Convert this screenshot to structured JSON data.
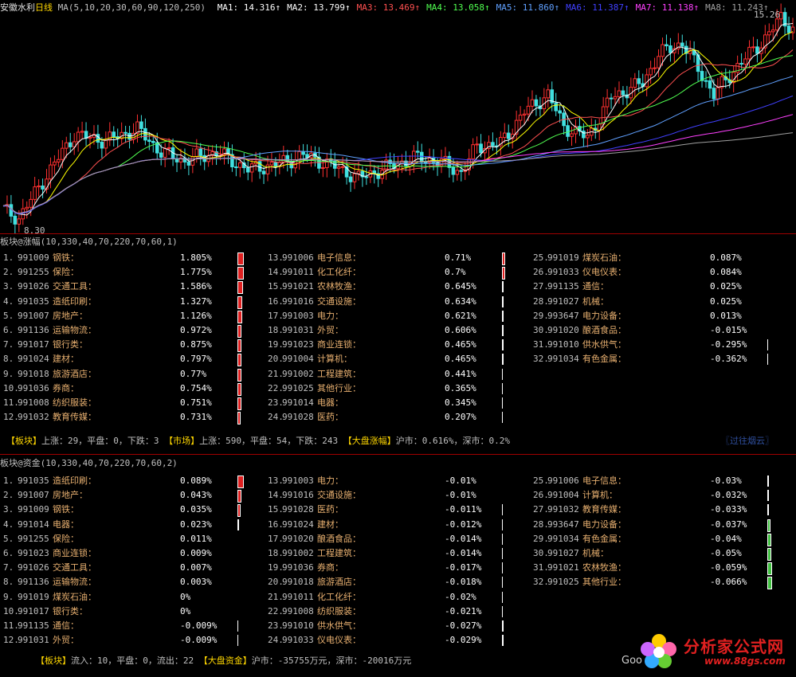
{
  "header": {
    "stock_name": "安徽水利",
    "period": "日线",
    "ma_params": "MA(5,10,20,30,60,90,120,250)",
    "ma_values": [
      {
        "label": "MA1:",
        "value": "14.316↑",
        "color": "#ffffff"
      },
      {
        "label": "MA2:",
        "value": "13.799↑",
        "color": "#ffffff"
      },
      {
        "label": "MA3:",
        "value": "13.469↑",
        "color": "#ff5050"
      },
      {
        "label": "MA4:",
        "value": "13.058↑",
        "color": "#50ff50"
      },
      {
        "label": "MA5:",
        "value": "11.860↑",
        "color": "#60a0ff"
      },
      {
        "label": "MA6:",
        "value": "11.387↑",
        "color": "#4040ff"
      },
      {
        "label": "MA7:",
        "value": "11.138↑",
        "color": "#ff40ff"
      },
      {
        "label": "MA8:",
        "value": "11.243↑",
        "color": "#a0a0a0"
      }
    ],
    "high_label": "15.26",
    "low_label": "8.30"
  },
  "rise_panel": {
    "title": "板块@涨幅(10,330,40,70,220,70,60,1)",
    "items": [
      {
        "rank": "1.",
        "code": "991009",
        "name": "钢铁：",
        "value": "1.805%",
        "bar": 1.805
      },
      {
        "rank": "2.",
        "code": "991255",
        "name": "保险：",
        "value": "1.775%",
        "bar": 1.775
      },
      {
        "rank": "3.",
        "code": "991026",
        "name": "交通工具：",
        "value": "1.586%",
        "bar": 1.586
      },
      {
        "rank": "4.",
        "code": "991035",
        "name": "造纸印刷：",
        "value": "1.327%",
        "bar": 1.327
      },
      {
        "rank": "5.",
        "code": "991007",
        "name": "房地产：",
        "value": "1.126%",
        "bar": 1.126
      },
      {
        "rank": "6.",
        "code": "991136",
        "name": "运输物流：",
        "value": "0.972%",
        "bar": 0.972
      },
      {
        "rank": "7.",
        "code": "991017",
        "name": "银行类：",
        "value": "0.875%",
        "bar": 0.875
      },
      {
        "rank": "8.",
        "code": "991024",
        "name": "建材：",
        "value": "0.797%",
        "bar": 0.797
      },
      {
        "rank": "9.",
        "code": "991018",
        "name": "旅游酒店：",
        "value": "0.77%",
        "bar": 0.77
      },
      {
        "rank": "10.",
        "code": "991036",
        "name": "券商：",
        "value": "0.754%",
        "bar": 0.754
      },
      {
        "rank": "11.",
        "code": "991008",
        "name": "纺织服装：",
        "value": "0.751%",
        "bar": 0.751
      },
      {
        "rank": "12.",
        "code": "991032",
        "name": "教育传媒：",
        "value": "0.731%",
        "bar": 0.731
      },
      {
        "rank": "13.",
        "code": "991006",
        "name": "电子信息：",
        "value": "0.71%",
        "bar": 0.71
      },
      {
        "rank": "14.",
        "code": "991011",
        "name": "化工化纤：",
        "value": "0.7%",
        "bar": 0.7
      },
      {
        "rank": "15.",
        "code": "991021",
        "name": "农林牧渔：",
        "value": "0.645%",
        "bar": 0.645
      },
      {
        "rank": "16.",
        "code": "991016",
        "name": "交通设施：",
        "value": "0.634%",
        "bar": 0.634
      },
      {
        "rank": "17.",
        "code": "991003",
        "name": "电力：",
        "value": "0.621%",
        "bar": 0.621
      },
      {
        "rank": "18.",
        "code": "991031",
        "name": "外贸：",
        "value": "0.606%",
        "bar": 0.606
      },
      {
        "rank": "19.",
        "code": "991023",
        "name": "商业连锁：",
        "value": "0.465%",
        "bar": 0.465
      },
      {
        "rank": "20.",
        "code": "991004",
        "name": "计算机：",
        "value": "0.465%",
        "bar": 0.465
      },
      {
        "rank": "21.",
        "code": "991002",
        "name": "工程建筑：",
        "value": "0.441%",
        "bar": 0.441
      },
      {
        "rank": "22.",
        "code": "991025",
        "name": "其他行业：",
        "value": "0.365%",
        "bar": 0.365
      },
      {
        "rank": "23.",
        "code": "991014",
        "name": "电器：",
        "value": "0.345%",
        "bar": 0.345
      },
      {
        "rank": "24.",
        "code": "991028",
        "name": "医药：",
        "value": "0.207%",
        "bar": 0.207
      },
      {
        "rank": "25.",
        "code": "991019",
        "name": "煤炭石油：",
        "value": "0.087%",
        "bar": 0.087
      },
      {
        "rank": "26.",
        "code": "991033",
        "name": "仪电仪表：",
        "value": "0.084%",
        "bar": 0.084
      },
      {
        "rank": "27.",
        "code": "991135",
        "name": "通信：",
        "value": "0.025%",
        "bar": 0.025
      },
      {
        "rank": "28.",
        "code": "991027",
        "name": "机械：",
        "value": "0.025%",
        "bar": 0.025
      },
      {
        "rank": "29.",
        "code": "993647",
        "name": "电力设备：",
        "value": "0.013%",
        "bar": 0.013
      },
      {
        "rank": "30.",
        "code": "991020",
        "name": "酿酒食品：",
        "value": "-0.015%",
        "bar": -0.015
      },
      {
        "rank": "31.",
        "code": "991010",
        "name": "供水供气：",
        "value": "-0.295%",
        "bar": -0.295
      },
      {
        "rank": "32.",
        "code": "991034",
        "name": "有色金属：",
        "value": "-0.362%",
        "bar": -0.362
      }
    ],
    "summary": {
      "tag1": "【板块】",
      "text1": "上涨：29，平盘：0，下跌：3",
      "tag2": "【市场】",
      "text2": "上涨：590，平盘：54，下跌：243",
      "tag3": "【大盘涨幅】",
      "text3": "沪市：0.616%，深市：0.2%"
    },
    "watermark": "〖过往烟云〗"
  },
  "fund_panel": {
    "title": "板块@资金(10,330,40,70,220,70,60,2)",
    "items": [
      {
        "rank": "1.",
        "code": "991035",
        "name": "造纸印刷：",
        "value": "0.089%",
        "bar": 0.089
      },
      {
        "rank": "2.",
        "code": "991007",
        "name": "房地产：",
        "value": "0.043%",
        "bar": 0.043
      },
      {
        "rank": "3.",
        "code": "991009",
        "name": "钢铁：",
        "value": "0.035%",
        "bar": 0.035
      },
      {
        "rank": "4.",
        "code": "991014",
        "name": "电器：",
        "value": "0.023%",
        "bar": 0.023
      },
      {
        "rank": "5.",
        "code": "991255",
        "name": "保险：",
        "value": "0.011%",
        "bar": 0
      },
      {
        "rank": "6.",
        "code": "991023",
        "name": "商业连锁：",
        "value": "0.009%",
        "bar": 0
      },
      {
        "rank": "7.",
        "code": "991026",
        "name": "交通工具：",
        "value": "0.007%",
        "bar": 0
      },
      {
        "rank": "8.",
        "code": "991136",
        "name": "运输物流：",
        "value": "0.003%",
        "bar": 0
      },
      {
        "rank": "9.",
        "code": "991019",
        "name": "煤炭石油：",
        "value": "0%",
        "bar": 0
      },
      {
        "rank": "10.",
        "code": "991017",
        "name": "银行类：",
        "value": "0%",
        "bar": 0
      },
      {
        "rank": "11.",
        "code": "991135",
        "name": "通信：",
        "value": "-0.009%",
        "bar": -0.009
      },
      {
        "rank": "12.",
        "code": "991031",
        "name": "外贸：",
        "value": "-0.009%",
        "bar": -0.009
      },
      {
        "rank": "13.",
        "code": "991003",
        "name": "电力：",
        "value": "-0.01%",
        "bar": 0
      },
      {
        "rank": "14.",
        "code": "991016",
        "name": "交通设施：",
        "value": "-0.01%",
        "bar": 0
      },
      {
        "rank": "15.",
        "code": "991028",
        "name": "医药：",
        "value": "-0.011%",
        "bar": -0.011
      },
      {
        "rank": "16.",
        "code": "991024",
        "name": "建材：",
        "value": "-0.012%",
        "bar": -0.012
      },
      {
        "rank": "17.",
        "code": "991020",
        "name": "酿酒食品：",
        "value": "-0.014%",
        "bar": -0.014
      },
      {
        "rank": "18.",
        "code": "991002",
        "name": "工程建筑：",
        "value": "-0.014%",
        "bar": -0.014
      },
      {
        "rank": "19.",
        "code": "991036",
        "name": "券商：",
        "value": "-0.017%",
        "bar": -0.017
      },
      {
        "rank": "20.",
        "code": "991018",
        "name": "旅游酒店：",
        "value": "-0.018%",
        "bar": -0.018
      },
      {
        "rank": "21.",
        "code": "991011",
        "name": "化工化纤：",
        "value": "-0.02%",
        "bar": -0.02
      },
      {
        "rank": "22.",
        "code": "991008",
        "name": "纺织服装：",
        "value": "-0.021%",
        "bar": -0.021
      },
      {
        "rank": "23.",
        "code": "991010",
        "name": "供水供气：",
        "value": "-0.027%",
        "bar": -0.027
      },
      {
        "rank": "24.",
        "code": "991033",
        "name": "仪电仪表：",
        "value": "-0.029%",
        "bar": -0.029
      },
      {
        "rank": "25.",
        "code": "991006",
        "name": "电子信息：",
        "value": "-0.03%",
        "bar": -0.03
      },
      {
        "rank": "26.",
        "code": "991004",
        "name": "计算机：",
        "value": "-0.032%",
        "bar": -0.032
      },
      {
        "rank": "27.",
        "code": "991032",
        "name": "教育传媒：",
        "value": "-0.033%",
        "bar": -0.033
      },
      {
        "rank": "28.",
        "code": "993647",
        "name": "电力设备：",
        "value": "-0.037%",
        "bar": -0.037
      },
      {
        "rank": "29.",
        "code": "991034",
        "name": "有色金属：",
        "value": "-0.04%",
        "bar": -0.04
      },
      {
        "rank": "30.",
        "code": "991027",
        "name": "机械：",
        "value": "-0.05%",
        "bar": -0.05
      },
      {
        "rank": "31.",
        "code": "991021",
        "name": "农林牧渔：",
        "value": "-0.059%",
        "bar": -0.059
      },
      {
        "rank": "32.",
        "code": "991025",
        "name": "其他行业：",
        "value": "-0.066%",
        "bar": -0.066
      }
    ],
    "summary": {
      "tag1": "【板块】",
      "text1": "流入：10，平盘：0，流出：22",
      "tag2": "【大盘资金】",
      "text2": "沪市：-35755万元，深市：-20016万元"
    }
  },
  "brand": {
    "cn": "分析家公式网",
    "url": "www.88gs.com",
    "partial": "Goo"
  },
  "colors": {
    "up": "#ff3030",
    "down": "#40e0e0",
    "pos_bar": "#e02020",
    "neg_bar": "#40c040",
    "name": "#e8b070"
  }
}
